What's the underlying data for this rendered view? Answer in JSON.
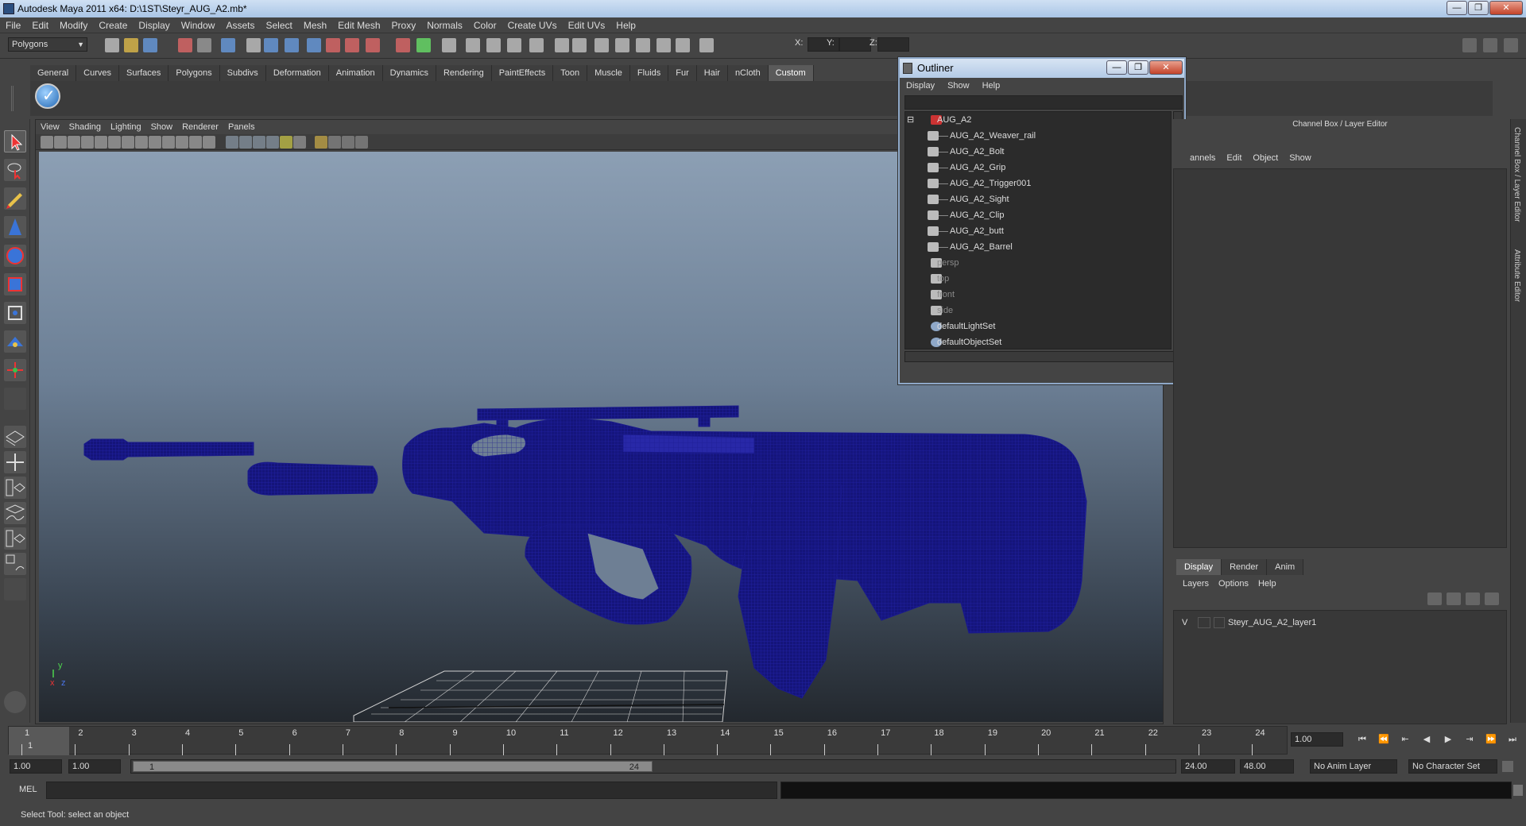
{
  "window": {
    "title": "Autodesk Maya 2011 x64: D:\\1ST\\Steyr_AUG_A2.mb*",
    "min": "—",
    "max": "❐",
    "close": "✕"
  },
  "menubar": [
    "File",
    "Edit",
    "Modify",
    "Create",
    "Display",
    "Window",
    "Assets",
    "Select",
    "Mesh",
    "Edit Mesh",
    "Proxy",
    "Normals",
    "Color",
    "Create UVs",
    "Edit UVs",
    "Help"
  ],
  "statusline": {
    "menu_set": "Polygons",
    "x_label": "X:",
    "y_label": "Y:",
    "z_label": "Z:"
  },
  "shelf": {
    "tabs": [
      "General",
      "Curves",
      "Surfaces",
      "Polygons",
      "Subdivs",
      "Deformation",
      "Animation",
      "Dynamics",
      "Rendering",
      "PaintEffects",
      "Toon",
      "Muscle",
      "Fluids",
      "Fur",
      "Hair",
      "nCloth",
      "Custom"
    ],
    "active_tab": "Custom"
  },
  "viewport": {
    "menu": [
      "View",
      "Shading",
      "Lighting",
      "Show",
      "Renderer",
      "Panels"
    ],
    "axis_y": "y",
    "axis_x": "x",
    "axis_z": "z",
    "wire_color": "#1a1a8c"
  },
  "outliner": {
    "title": "Outliner",
    "menu": [
      "Display",
      "Show",
      "Help"
    ],
    "items": [
      {
        "label": "AUG_A2",
        "indent": 0,
        "dim": false,
        "expander": "⊟"
      },
      {
        "label": "AUG_A2_Weaver_rail",
        "indent": 1,
        "dim": false
      },
      {
        "label": "AUG_A2_Bolt",
        "indent": 1,
        "dim": false
      },
      {
        "label": "AUG_A2_Grip",
        "indent": 1,
        "dim": false
      },
      {
        "label": "AUG_A2_Trigger001",
        "indent": 1,
        "dim": false
      },
      {
        "label": "AUG_A2_Sight",
        "indent": 1,
        "dim": false
      },
      {
        "label": "AUG_A2_Clip",
        "indent": 1,
        "dim": false
      },
      {
        "label": "AUG_A2_butt",
        "indent": 1,
        "dim": false
      },
      {
        "label": "AUG_A2_Barrel",
        "indent": 1,
        "dim": false
      },
      {
        "label": "persp",
        "indent": 0,
        "dim": true
      },
      {
        "label": "top",
        "indent": 0,
        "dim": true
      },
      {
        "label": "front",
        "indent": 0,
        "dim": true
      },
      {
        "label": "side",
        "indent": 0,
        "dim": true
      },
      {
        "label": "defaultLightSet",
        "indent": 0,
        "dim": false
      },
      {
        "label": "defaultObjectSet",
        "indent": 0,
        "dim": false
      }
    ]
  },
  "channelbox": {
    "title": "Channel Box / Layer Editor",
    "menu": [
      "annels",
      "Edit",
      "Object",
      "Show"
    ]
  },
  "layereditor": {
    "tabs": [
      "Display",
      "Render",
      "Anim"
    ],
    "active_tab": "Display",
    "menu": [
      "Layers",
      "Options",
      "Help"
    ],
    "layer": {
      "visible": "V",
      "name": "Steyr_AUG_A2_layer1"
    }
  },
  "sidetabs": [
    "Channel Box / Layer Editor",
    "Attribute Editor"
  ],
  "timeslider": {
    "ticks": [
      "1",
      "2",
      "3",
      "4",
      "5",
      "6",
      "7",
      "8",
      "9",
      "10",
      "11",
      "12",
      "13",
      "14",
      "15",
      "16",
      "17",
      "18",
      "19",
      "20",
      "21",
      "22",
      "23",
      "24"
    ],
    "current": "1",
    "current_field": "1.00"
  },
  "playback": [
    "⏮",
    "⏪",
    "⇤",
    "◀",
    "▶",
    "⇥",
    "⏩",
    "⏭"
  ],
  "range": {
    "start": "1.00",
    "playback_start": "1.00",
    "thumb_start": "1",
    "thumb_end": "24",
    "playback_end": "24.00",
    "end": "48.00",
    "anim_layer": "No Anim Layer",
    "character_set": "No Character Set"
  },
  "commandline": {
    "label": "MEL"
  },
  "helpline": {
    "text": "Select Tool: select an object"
  }
}
